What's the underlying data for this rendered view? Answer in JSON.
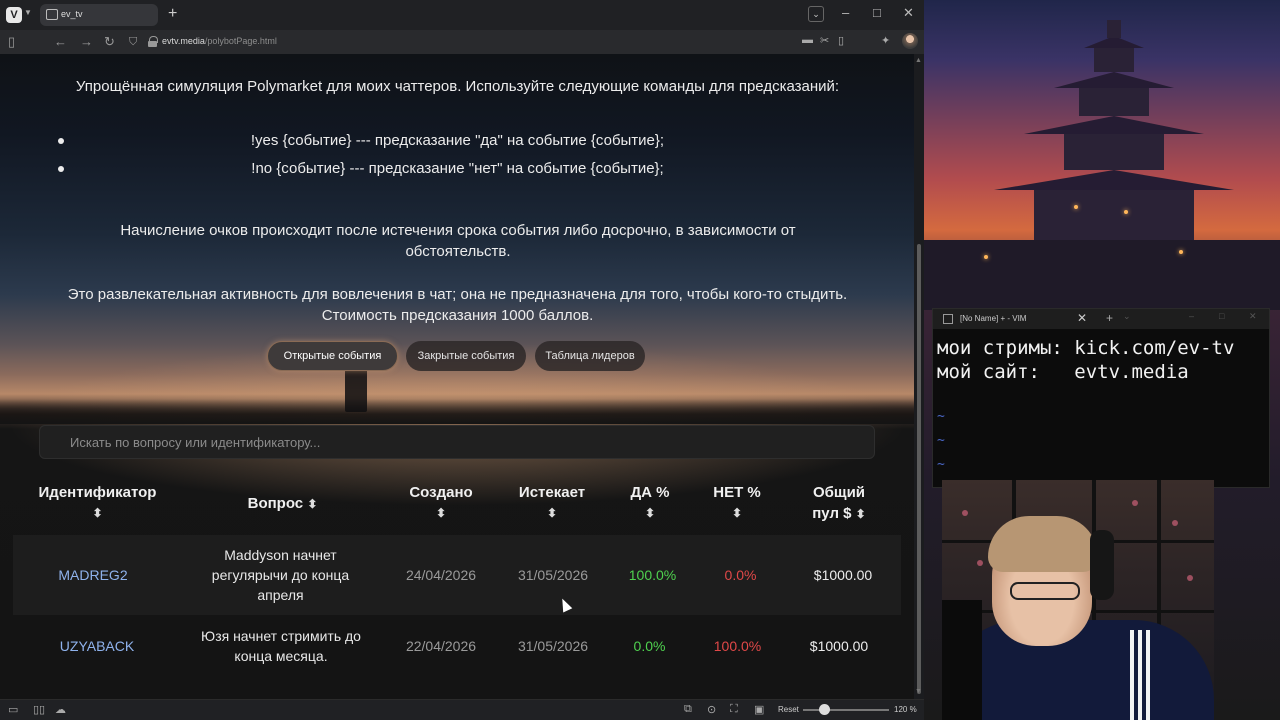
{
  "browser": {
    "tab_title": "ev_tv",
    "new_tab": "+",
    "url_domain": "evtv.media",
    "url_path": "/polybotPage.html",
    "window_controls": [
      "–",
      "□",
      "✕"
    ]
  },
  "page": {
    "intro": "Упрощённая симуляция Polymarket для моих чаттеров. Используйте следующие команды для предсказаний:",
    "commands": [
      "!yes {событие} --- предсказание \"да\" на событие {событие};",
      "!no {событие} --- предсказание \"нет\" на событие {событие};"
    ],
    "scoring": "Начисление очков происходит после истечения срока события либо досрочно, в зависимости от обстоятельств.",
    "disclaimer": "Это развлекательная активность для вовлечения в чат; она не предназначена для того, чтобы кого-то стыдить. Стоимость предсказания 1000 баллов.",
    "tabs": [
      "Открытые события",
      "Закрытые события",
      "Таблица лидеров"
    ],
    "active_tab": 0,
    "search_placeholder": "Искать по вопросу или идентификатору...",
    "columns": {
      "id": "Идентификатор",
      "question": "Вопрос",
      "created": "Создано",
      "expires": "Истекает",
      "yes": "ДА %",
      "no": "НЕТ %",
      "pool_1": "Общий",
      "pool_2": "пул $",
      "sort_glyph": "⬍"
    },
    "rows": [
      {
        "id": "MADREG2",
        "question": "Maddyson начнет регулярычи до конца апреля",
        "created": "24/04/2026",
        "expires": "31/05/2026",
        "yes": "100.0%",
        "no": "0.0%",
        "pool": "$1000.00"
      },
      {
        "id": "UZYABACK",
        "question": "Юзя начнет стримить до конца месяца.",
        "created": "22/04/2026",
        "expires": "31/05/2026",
        "yes": "0.0%",
        "no": "100.0%",
        "pool": "$1000.00"
      }
    ]
  },
  "statusbar": {
    "reset": "Reset",
    "zoom": "120 %"
  },
  "vim": {
    "title": "[No Name] + - VIM",
    "line1": "мои стримы: kick.com/ev-tv",
    "line2": "мой сайт:   evtv.media",
    "tilde": "~"
  },
  "colors": {
    "link": "#8fb2ec",
    "yes": "#4fd14f",
    "no": "#e04848",
    "active_tab_glow": "#8a6b55"
  }
}
